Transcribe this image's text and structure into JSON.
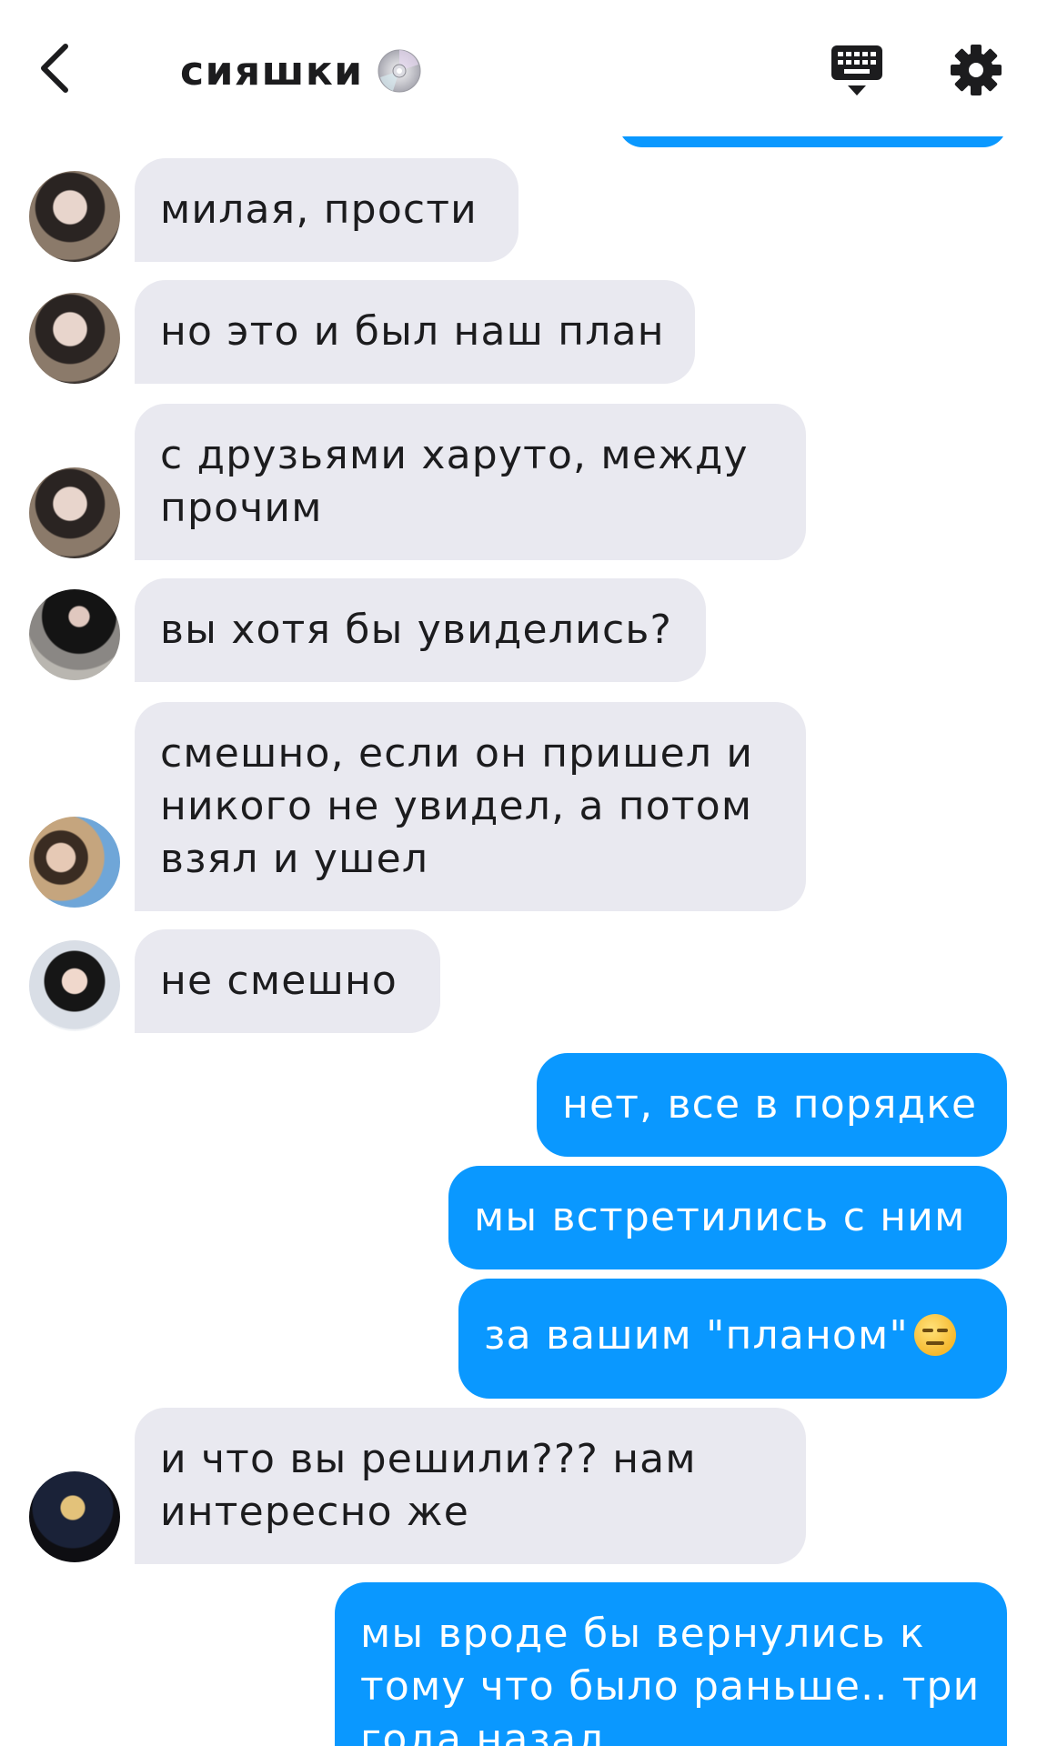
{
  "header": {
    "title": "сияшки",
    "back_icon": "chevron-left-icon",
    "title_icon": "cd-disc-icon",
    "keyboard_icon": "keyboard-icon",
    "settings_icon": "gear-icon"
  },
  "colors": {
    "incoming_bubble": "#e9e9f0",
    "outgoing_bubble": "#0a98ff",
    "text": "#1c1c1e"
  },
  "messages": [
    {
      "direction": "in",
      "text": "милая, прости"
    },
    {
      "direction": "in",
      "text": "но это и был наш план"
    },
    {
      "direction": "in",
      "text": "с друзьями харуто, между прочим"
    },
    {
      "direction": "in",
      "text": "вы хотя бы увиделись?"
    },
    {
      "direction": "in",
      "text": "смешно, если он пришел и никого не увидел, а потом взял и ушел"
    },
    {
      "direction": "in",
      "text": "не смешно"
    },
    {
      "direction": "out",
      "text": "нет, все в порядке"
    },
    {
      "direction": "out",
      "text": "мы встретились с ним"
    },
    {
      "direction": "out",
      "text": "за вашим \"планом\"",
      "emoji": "expressionless-face-emoji"
    },
    {
      "direction": "in",
      "text": "и что вы решили??? нам интересно же"
    },
    {
      "direction": "out",
      "text": "мы вроде бы вернулись к тому что было раньше.. три года назад"
    }
  ]
}
